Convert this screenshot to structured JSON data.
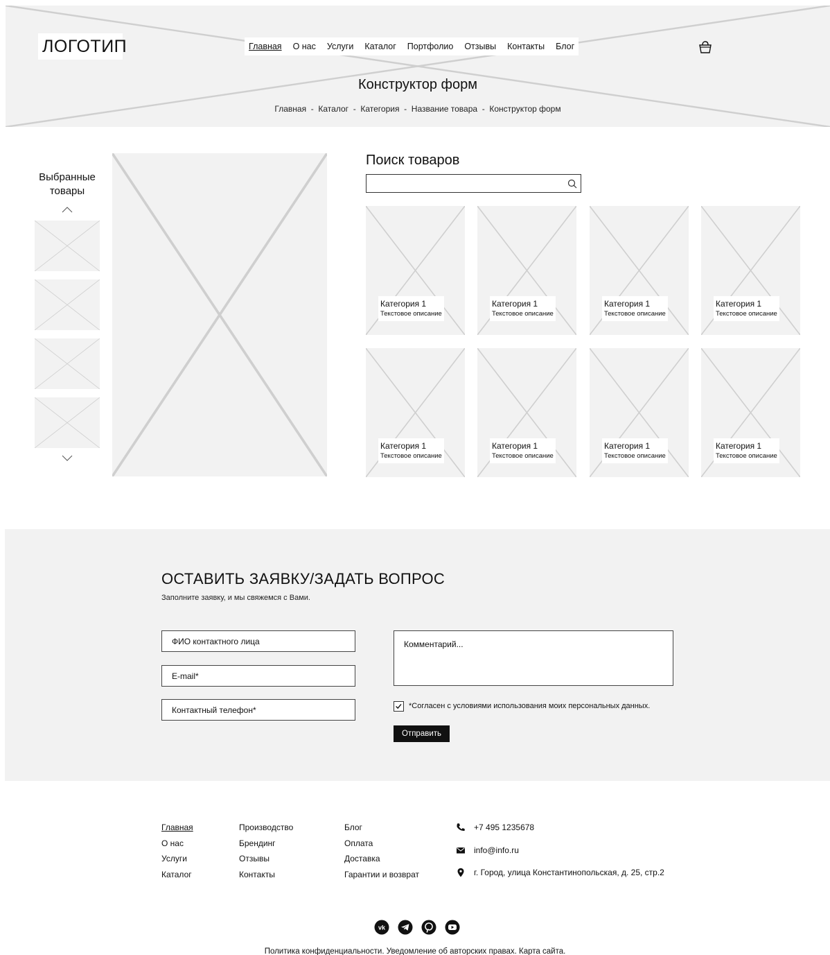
{
  "header": {
    "logo": "ЛОГОТИП",
    "nav": [
      "Главная",
      "О нас",
      "Услуги",
      "Каталог",
      "Портфолио",
      "Отзывы",
      "Контакты",
      "Блог"
    ],
    "active_nav": "Главная",
    "cart_icon": "shopping-bag-icon",
    "title": "Конструктор форм",
    "breadcrumb": "Главная  -  Каталог  -  Категория  -  Название товара  -  Конструктор форм"
  },
  "gallery": {
    "title": "Выбранные товары",
    "up_icon": "chevron-up-icon",
    "down_icon": "chevron-down-icon"
  },
  "search": {
    "title": "Поиск товаров",
    "value": "",
    "icon": "search-icon"
  },
  "products": [
    {
      "title": "Категория 1",
      "desc": "Текстовое описание"
    },
    {
      "title": "Категория 1",
      "desc": "Текстовое описание"
    },
    {
      "title": "Категория 1",
      "desc": "Текстовое описание"
    },
    {
      "title": "Категория 1",
      "desc": "Текстовое описание"
    },
    {
      "title": "Категория 1",
      "desc": "Текстовое описание"
    },
    {
      "title": "Категория 1",
      "desc": "Текстовое описание"
    },
    {
      "title": "Категория 1",
      "desc": "Текстовое описание"
    },
    {
      "title": "Категория 1",
      "desc": "Текстовое описание"
    }
  ],
  "form": {
    "title": "ОСТАВИТЬ ЗАЯВКУ/ЗАДАТЬ ВОПРОС",
    "subtitle": "Заполните заявку, и мы свяжемся с Вами.",
    "name_placeholder": "ФИО контактного лица",
    "email_placeholder": "E-mail*",
    "phone_placeholder": "Контактный телефон*",
    "comment_placeholder": "Комментарий...",
    "consent": "*Согласен с условиями использования моих персональных данных.",
    "consent_checked": true,
    "submit": "Отправить"
  },
  "footer": {
    "col1": [
      "Главная",
      "О нас",
      "Услуги",
      "Каталог"
    ],
    "col2": [
      "Производство",
      "Брендинг",
      "Отзывы",
      "Контакты"
    ],
    "col3": [
      "Блог",
      "Оплата",
      "Доставка",
      "Гарантии и возврат"
    ],
    "phone": "+7 495 1235678",
    "email": "info@info.ru",
    "address": "г. Город, улица Константинопольская, д. 25, стр.2",
    "socials": [
      "vk-icon",
      "telegram-icon",
      "pinterest-icon",
      "youtube-icon"
    ],
    "legal": "Политика конфиденциальности. Уведомление об авторских правах. Карта сайта."
  }
}
